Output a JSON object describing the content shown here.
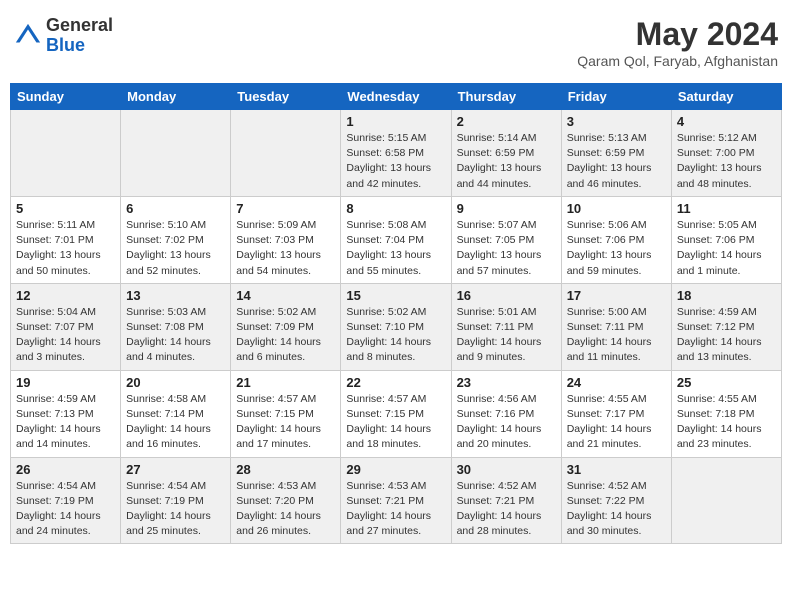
{
  "header": {
    "logo": {
      "general": "General",
      "blue": "Blue"
    },
    "month": "May 2024",
    "location": "Qaram Qol, Faryab, Afghanistan"
  },
  "weekdays": [
    "Sunday",
    "Monday",
    "Tuesday",
    "Wednesday",
    "Thursday",
    "Friday",
    "Saturday"
  ],
  "weeks": [
    {
      "days": [
        {
          "num": "",
          "empty": true
        },
        {
          "num": "",
          "empty": true
        },
        {
          "num": "",
          "empty": true
        },
        {
          "num": "1",
          "sunrise": "5:15 AM",
          "sunset": "6:58 PM",
          "daylight": "13 hours and 42 minutes."
        },
        {
          "num": "2",
          "sunrise": "5:14 AM",
          "sunset": "6:59 PM",
          "daylight": "13 hours and 44 minutes."
        },
        {
          "num": "3",
          "sunrise": "5:13 AM",
          "sunset": "6:59 PM",
          "daylight": "13 hours and 46 minutes."
        },
        {
          "num": "4",
          "sunrise": "5:12 AM",
          "sunset": "7:00 PM",
          "daylight": "13 hours and 48 minutes."
        }
      ]
    },
    {
      "days": [
        {
          "num": "5",
          "sunrise": "5:11 AM",
          "sunset": "7:01 PM",
          "daylight": "13 hours and 50 minutes."
        },
        {
          "num": "6",
          "sunrise": "5:10 AM",
          "sunset": "7:02 PM",
          "daylight": "13 hours and 52 minutes."
        },
        {
          "num": "7",
          "sunrise": "5:09 AM",
          "sunset": "7:03 PM",
          "daylight": "13 hours and 54 minutes."
        },
        {
          "num": "8",
          "sunrise": "5:08 AM",
          "sunset": "7:04 PM",
          "daylight": "13 hours and 55 minutes."
        },
        {
          "num": "9",
          "sunrise": "5:07 AM",
          "sunset": "7:05 PM",
          "daylight": "13 hours and 57 minutes."
        },
        {
          "num": "10",
          "sunrise": "5:06 AM",
          "sunset": "7:06 PM",
          "daylight": "13 hours and 59 minutes."
        },
        {
          "num": "11",
          "sunrise": "5:05 AM",
          "sunset": "7:06 PM",
          "daylight": "14 hours and 1 minute."
        }
      ]
    },
    {
      "days": [
        {
          "num": "12",
          "sunrise": "5:04 AM",
          "sunset": "7:07 PM",
          "daylight": "14 hours and 3 minutes."
        },
        {
          "num": "13",
          "sunrise": "5:03 AM",
          "sunset": "7:08 PM",
          "daylight": "14 hours and 4 minutes."
        },
        {
          "num": "14",
          "sunrise": "5:02 AM",
          "sunset": "7:09 PM",
          "daylight": "14 hours and 6 minutes."
        },
        {
          "num": "15",
          "sunrise": "5:02 AM",
          "sunset": "7:10 PM",
          "daylight": "14 hours and 8 minutes."
        },
        {
          "num": "16",
          "sunrise": "5:01 AM",
          "sunset": "7:11 PM",
          "daylight": "14 hours and 9 minutes."
        },
        {
          "num": "17",
          "sunrise": "5:00 AM",
          "sunset": "7:11 PM",
          "daylight": "14 hours and 11 minutes."
        },
        {
          "num": "18",
          "sunrise": "4:59 AM",
          "sunset": "7:12 PM",
          "daylight": "14 hours and 13 minutes."
        }
      ]
    },
    {
      "days": [
        {
          "num": "19",
          "sunrise": "4:59 AM",
          "sunset": "7:13 PM",
          "daylight": "14 hours and 14 minutes."
        },
        {
          "num": "20",
          "sunrise": "4:58 AM",
          "sunset": "7:14 PM",
          "daylight": "14 hours and 16 minutes."
        },
        {
          "num": "21",
          "sunrise": "4:57 AM",
          "sunset": "7:15 PM",
          "daylight": "14 hours and 17 minutes."
        },
        {
          "num": "22",
          "sunrise": "4:57 AM",
          "sunset": "7:15 PM",
          "daylight": "14 hours and 18 minutes."
        },
        {
          "num": "23",
          "sunrise": "4:56 AM",
          "sunset": "7:16 PM",
          "daylight": "14 hours and 20 minutes."
        },
        {
          "num": "24",
          "sunrise": "4:55 AM",
          "sunset": "7:17 PM",
          "daylight": "14 hours and 21 minutes."
        },
        {
          "num": "25",
          "sunrise": "4:55 AM",
          "sunset": "7:18 PM",
          "daylight": "14 hours and 23 minutes."
        }
      ]
    },
    {
      "days": [
        {
          "num": "26",
          "sunrise": "4:54 AM",
          "sunset": "7:19 PM",
          "daylight": "14 hours and 24 minutes."
        },
        {
          "num": "27",
          "sunrise": "4:54 AM",
          "sunset": "7:19 PM",
          "daylight": "14 hours and 25 minutes."
        },
        {
          "num": "28",
          "sunrise": "4:53 AM",
          "sunset": "7:20 PM",
          "daylight": "14 hours and 26 minutes."
        },
        {
          "num": "29",
          "sunrise": "4:53 AM",
          "sunset": "7:21 PM",
          "daylight": "14 hours and 27 minutes."
        },
        {
          "num": "30",
          "sunrise": "4:52 AM",
          "sunset": "7:21 PM",
          "daylight": "14 hours and 28 minutes."
        },
        {
          "num": "31",
          "sunrise": "4:52 AM",
          "sunset": "7:22 PM",
          "daylight": "14 hours and 30 minutes."
        },
        {
          "num": "",
          "empty": true
        }
      ]
    }
  ],
  "labels": {
    "sunrise": "Sunrise:",
    "sunset": "Sunset:",
    "daylight": "Daylight:"
  }
}
